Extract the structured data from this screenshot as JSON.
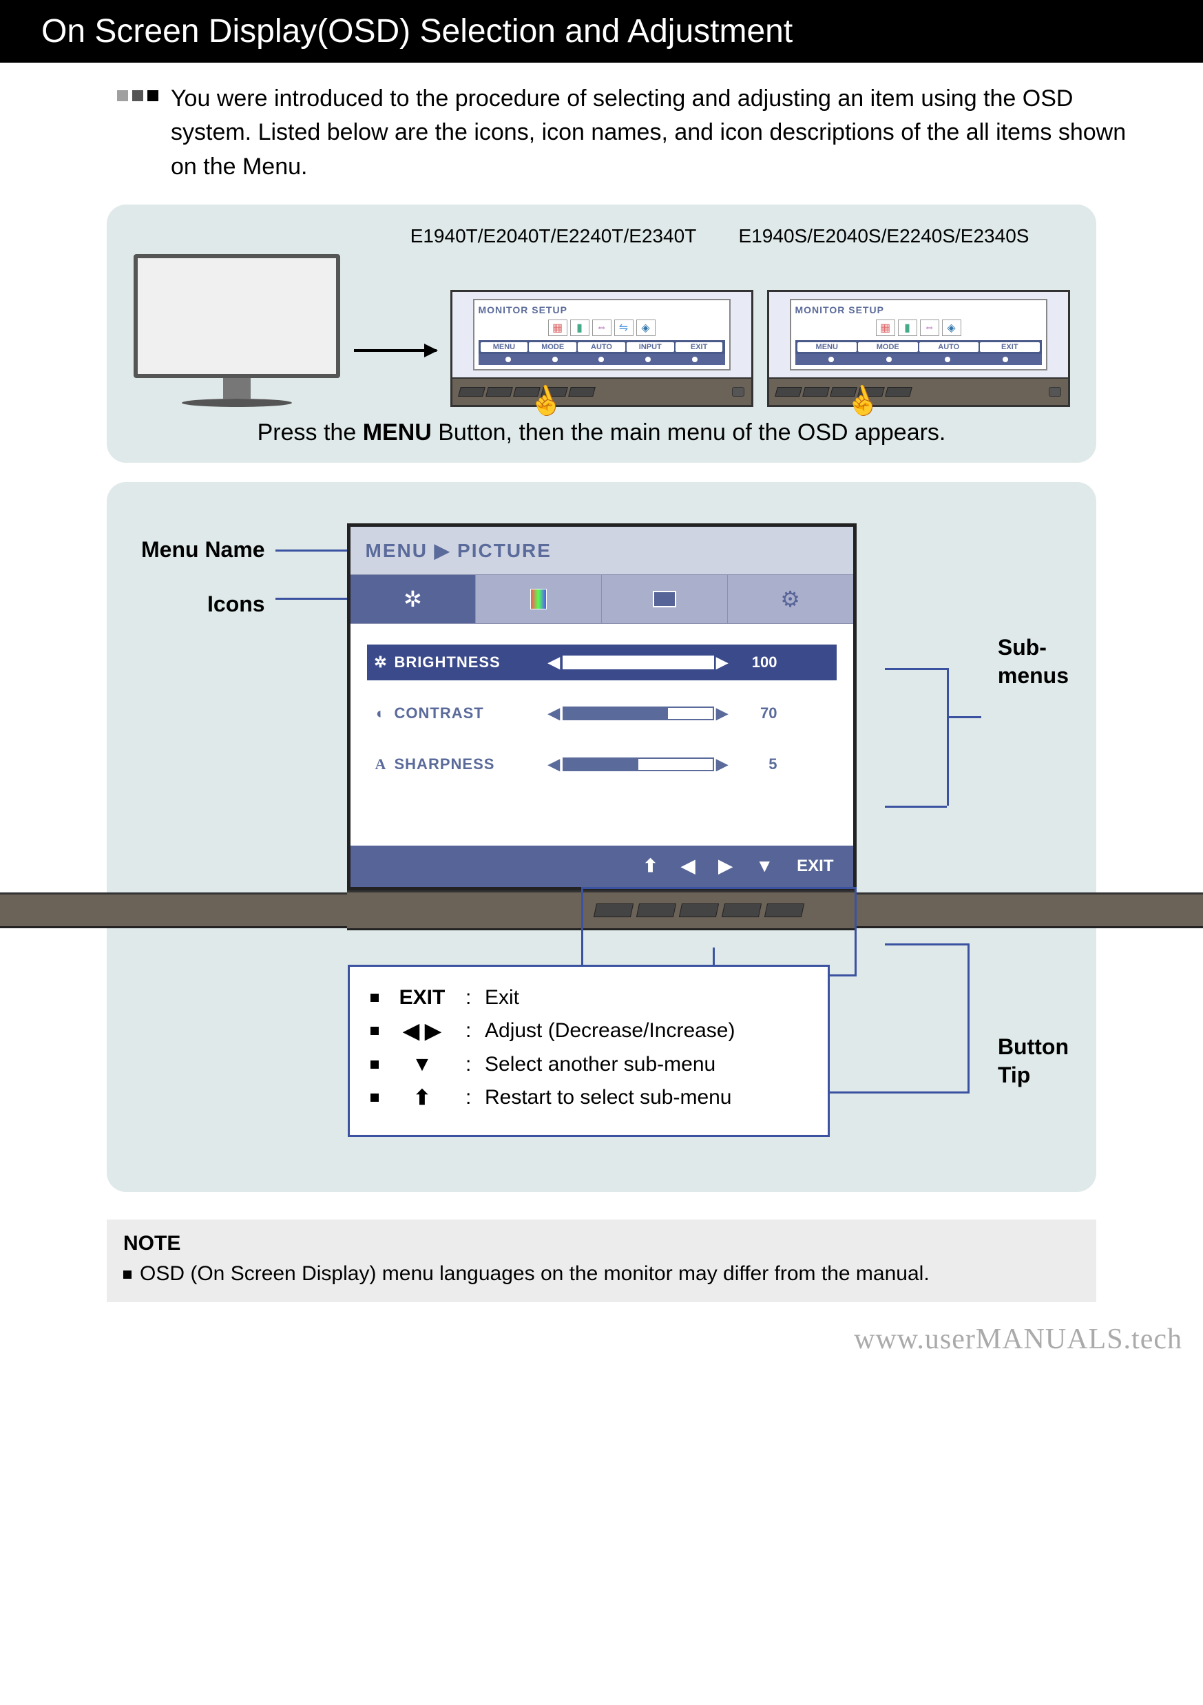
{
  "title": "On Screen Display(OSD) Selection and Adjustment",
  "intro": "You were introduced to the procedure of selecting and adjusting an item using the OSD system. Listed below are the icons, icon names, and icon descriptions of the all items shown on the Menu.",
  "models": {
    "t": "E1940T/E2040T/E2240T/E2340T",
    "s": "E1940S/E2040S/E2240S/E2340S"
  },
  "mini_osd": {
    "title": "MONITOR SETUP",
    "btns_t": [
      "MENU",
      "MODE",
      "AUTO",
      "INPUT",
      "EXIT"
    ],
    "btns_s": [
      "MENU",
      "MODE",
      "AUTO",
      "EXIT"
    ]
  },
  "press_prefix": "Press the ",
  "press_bold": "MENU",
  "press_suffix": " Button, then the main menu of the OSD appears.",
  "labels": {
    "menuName": "Menu Name",
    "icons": "Icons",
    "submenus1": "Sub-",
    "submenus2": "menus",
    "buttonTip1": "Button",
    "buttonTip2": "Tip"
  },
  "osd": {
    "header": "MENU ▶ PICTURE",
    "tabs": [
      "✲",
      "▮▮▮",
      "▭",
      "⚙"
    ],
    "rows": [
      {
        "icon": "✲",
        "label": "BRIGHTNESS",
        "value": 100,
        "pct": 100,
        "active": true
      },
      {
        "icon": "◐",
        "label": "CONTRAST",
        "value": 70,
        "pct": 70,
        "active": false
      },
      {
        "icon": "A",
        "label": "SHARPNESS",
        "value": 5,
        "pct": 50,
        "active": false
      }
    ],
    "footer": {
      "up": "⬆",
      "left": "◀",
      "right": "▶",
      "down": "▼",
      "exit": "EXIT"
    }
  },
  "tips": [
    {
      "key": "EXIT",
      "desc": "Exit"
    },
    {
      "key": "◀ ▶",
      "desc": "Adjust (Decrease/Increase)"
    },
    {
      "key": "▼",
      "desc": "Select another sub-menu"
    },
    {
      "key": "⬆",
      "desc": "Restart to select sub-menu"
    }
  ],
  "note": {
    "title": "NOTE",
    "text": "OSD (On Screen Display) menu languages on the monitor may differ from the manual."
  },
  "watermark": "www.userMANUALS.tech"
}
